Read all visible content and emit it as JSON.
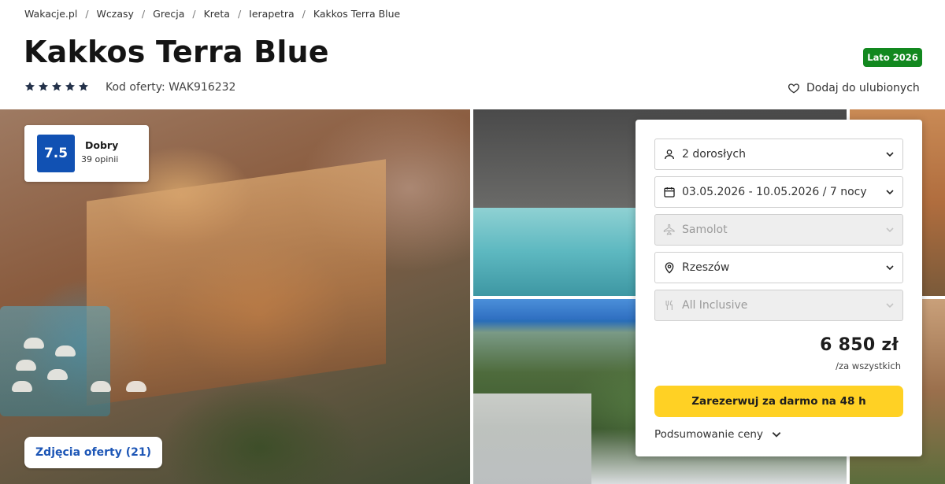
{
  "breadcrumb": [
    "Wakacje.pl",
    "Wczasy",
    "Grecja",
    "Kreta",
    "Ierapetra",
    "Kakkos Terra Blue"
  ],
  "title": "Kakkos Terra Blue",
  "season_badge": "Lato 2026",
  "stars": 5,
  "offer_code": "Kod oferty: WAK916232",
  "favorite_label": "Dodaj do ulubionych",
  "rating": {
    "score": "7.5",
    "label": "Dobry",
    "count": "39 opinii"
  },
  "photos_button": "Zdjęcia oferty (21)",
  "booking": {
    "fields": [
      {
        "name": "travelers",
        "value": "2 dorosłych",
        "icon": "person-icon",
        "disabled": false
      },
      {
        "name": "dates",
        "value": "03.05.2026 - 10.05.2026 / 7 nocy",
        "icon": "calendar-icon",
        "disabled": false
      },
      {
        "name": "transport",
        "value": "Samolot",
        "icon": "plane-icon",
        "disabled": true
      },
      {
        "name": "departure",
        "value": "Rzeszów",
        "icon": "location-pin-icon",
        "disabled": false
      },
      {
        "name": "board",
        "value": "All Inclusive",
        "icon": "fork-knife-icon",
        "disabled": true
      }
    ],
    "price": "6 850 zł",
    "price_note": "/za wszystkich",
    "book_button": "Zarezerwuj za darmo na 48 h",
    "summary_link": "Podsumowanie ceny"
  },
  "colors": {
    "accent_blue": "#1151b3",
    "badge_green": "#12881f",
    "cta_yellow": "#ffd124",
    "star": "#24324a"
  }
}
